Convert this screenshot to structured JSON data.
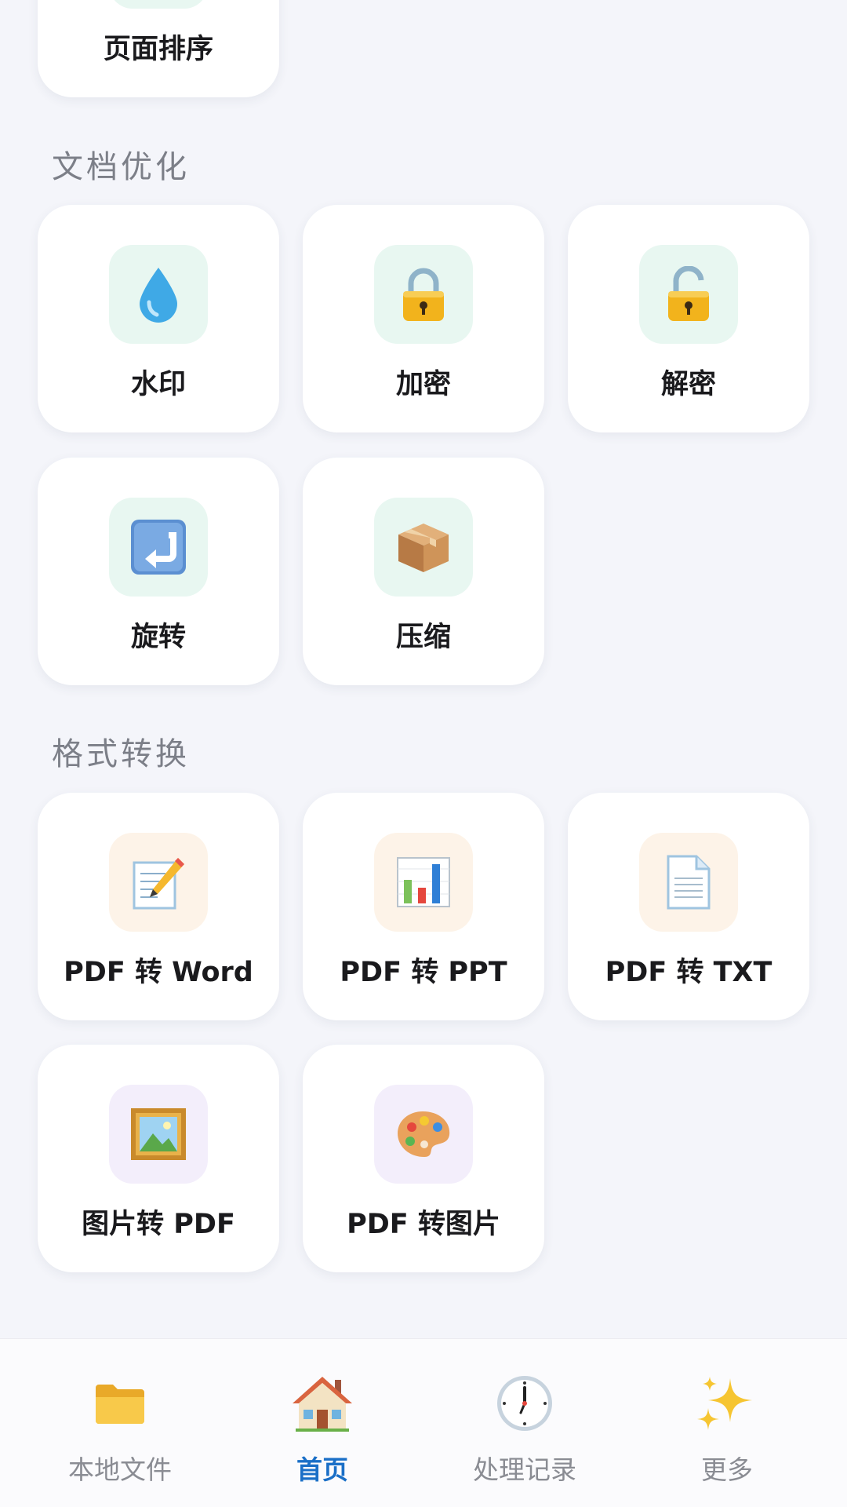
{
  "sections": {
    "partial_card_label": "页面排序",
    "optimize_title": "文档优化",
    "convert_title": "格式转换"
  },
  "optimize_tools": [
    {
      "label": "水印",
      "icon": "droplet-icon"
    },
    {
      "label": "加密",
      "icon": "lock-icon"
    },
    {
      "label": "解密",
      "icon": "unlock-icon"
    },
    {
      "label": "旋转",
      "icon": "rotate-arrow-icon"
    },
    {
      "label": "压缩",
      "icon": "package-box-icon"
    }
  ],
  "convert_tools": [
    {
      "label": "PDF 转 Word",
      "icon": "memo-pencil-icon"
    },
    {
      "label": "PDF 转 PPT",
      "icon": "bar-chart-icon"
    },
    {
      "label": "PDF 转 TXT",
      "icon": "document-icon"
    },
    {
      "label": "图片转 PDF",
      "icon": "framed-picture-icon"
    },
    {
      "label": "PDF 转图片",
      "icon": "palette-icon"
    }
  ],
  "bottom_nav": [
    {
      "label": "本地文件",
      "icon": "folder-icon",
      "active": false
    },
    {
      "label": "首页",
      "icon": "house-icon",
      "active": true
    },
    {
      "label": "处理记录",
      "icon": "clock-icon",
      "active": false
    },
    {
      "label": "更多",
      "icon": "sparkles-icon",
      "active": false
    }
  ],
  "colors": {
    "background": "#f4f5fa",
    "accent": "#1a6fc7",
    "icon_bg_green": "#e8f7f1",
    "icon_bg_orange": "#fdf3e8",
    "icon_bg_purple": "#f3eefb"
  }
}
